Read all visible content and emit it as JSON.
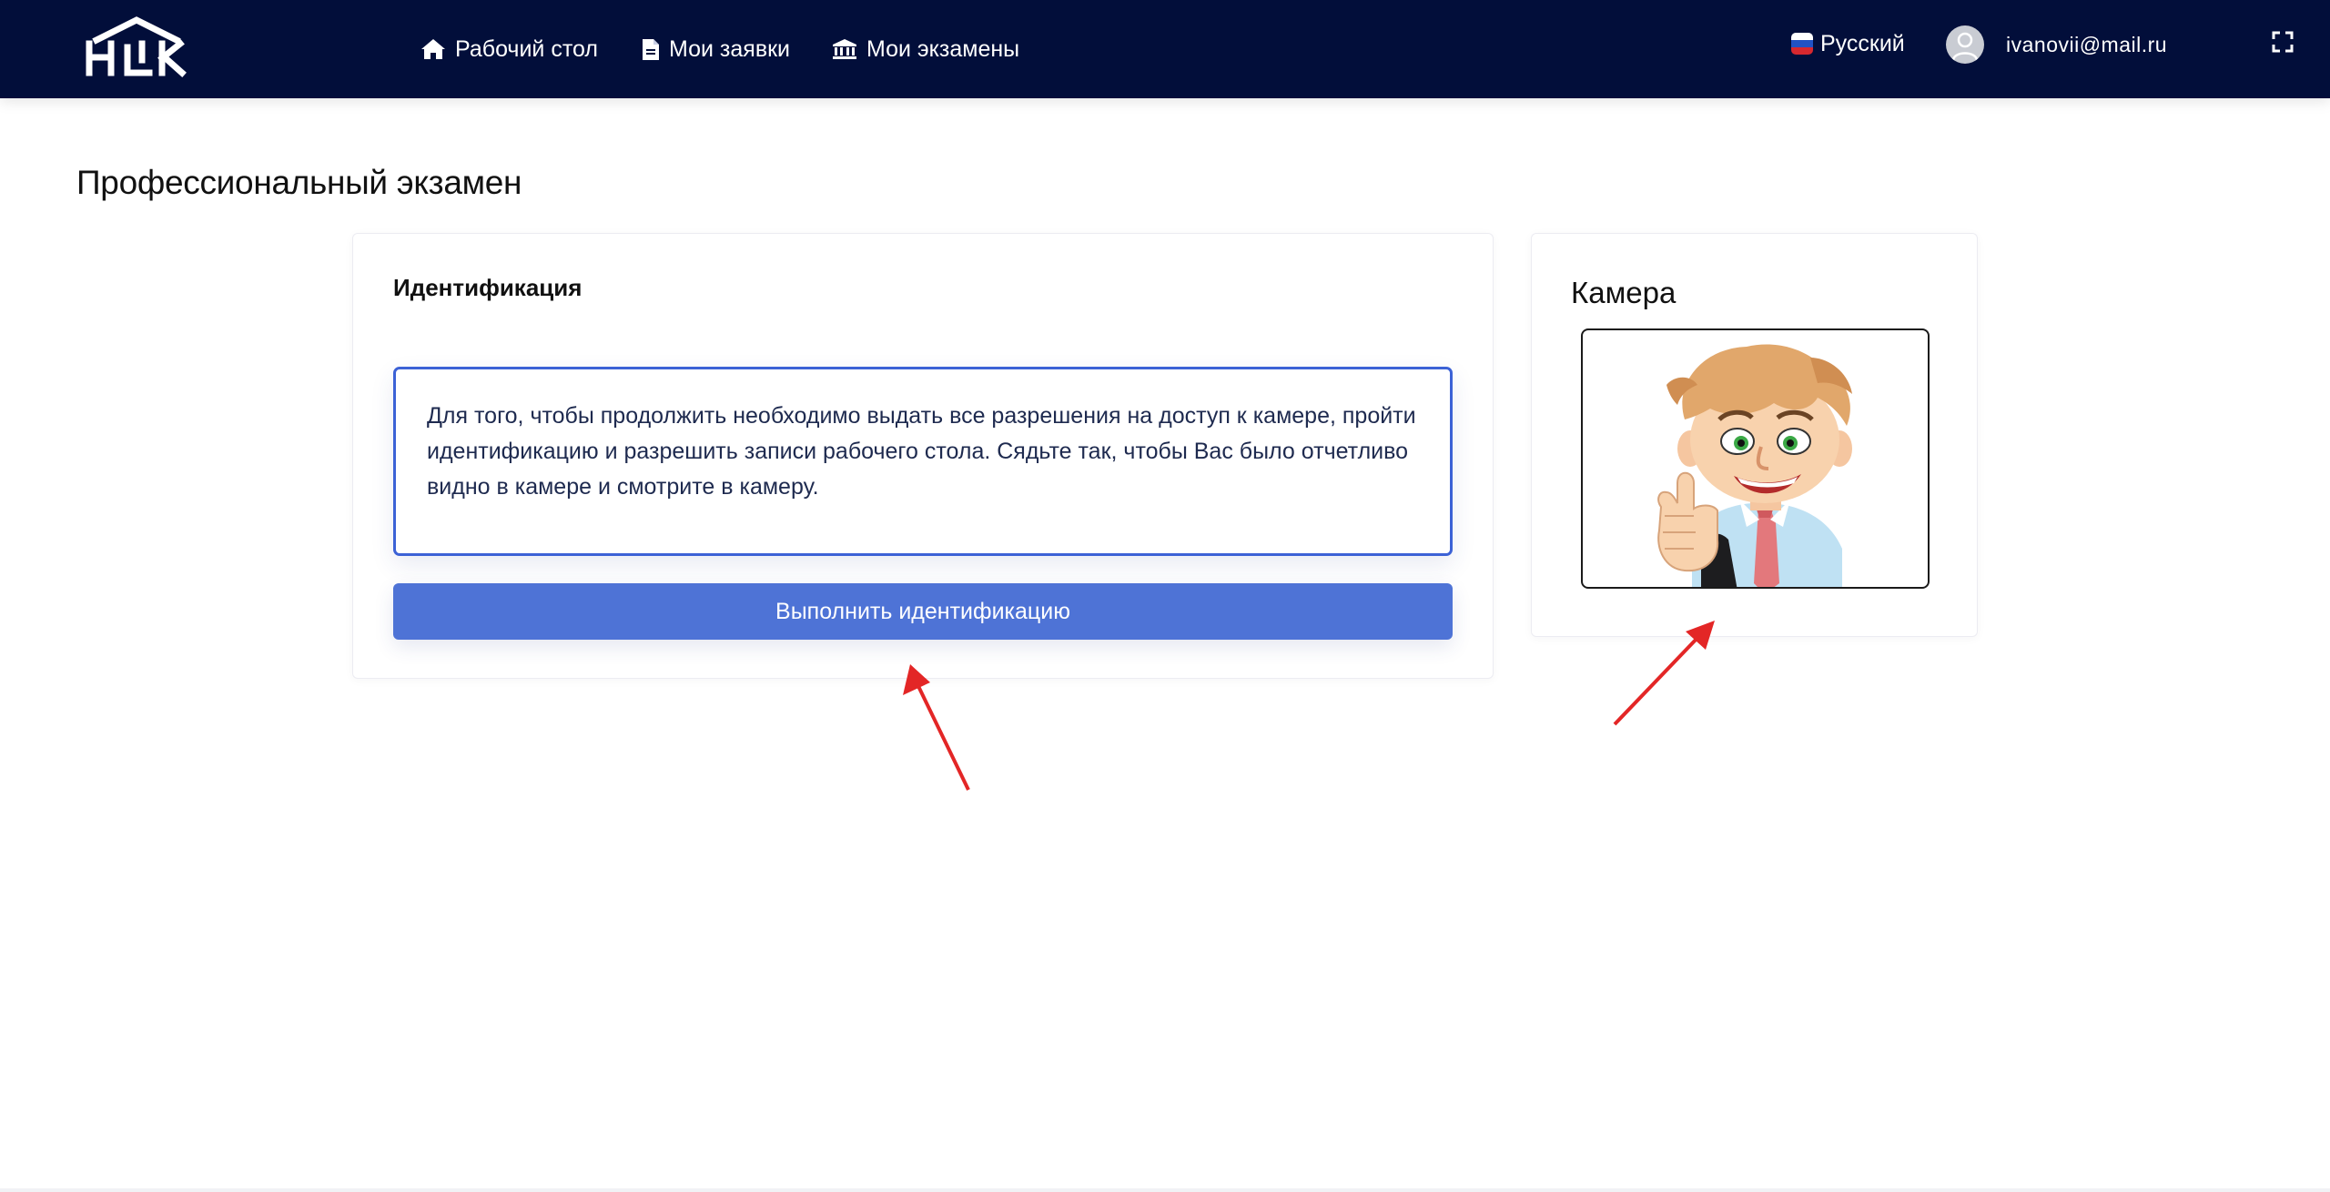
{
  "nav": {
    "desktop": "Рабочий стол",
    "requests": "Мои заявки",
    "exams": "Мои экзамены"
  },
  "header": {
    "language": "Русский",
    "user_email": "ivanovii@mail.ru"
  },
  "page": {
    "title": "Профессиональный экзамен"
  },
  "identification": {
    "title": "Идентификация",
    "message": "Для того, чтобы продолжить необходимо выдать все разрешения на доступ к камере, пройти идентификацию и разрешить записи рабочего стола. Сядьте так, чтобы Вас было отчетливо видно в камере и смотрите в камеру.",
    "button_label": "Выполнить идентификацию"
  },
  "camera": {
    "title": "Камера"
  },
  "colors": {
    "header_bg": "#020e3a",
    "accent": "#4e73d6",
    "info_border": "#3c62d6",
    "annotation_arrow": "#e32626"
  },
  "icons": [
    "logo",
    "home-icon",
    "document-icon",
    "institution-icon",
    "russia-flag-icon",
    "user-avatar-icon",
    "fullscreen-icon"
  ]
}
